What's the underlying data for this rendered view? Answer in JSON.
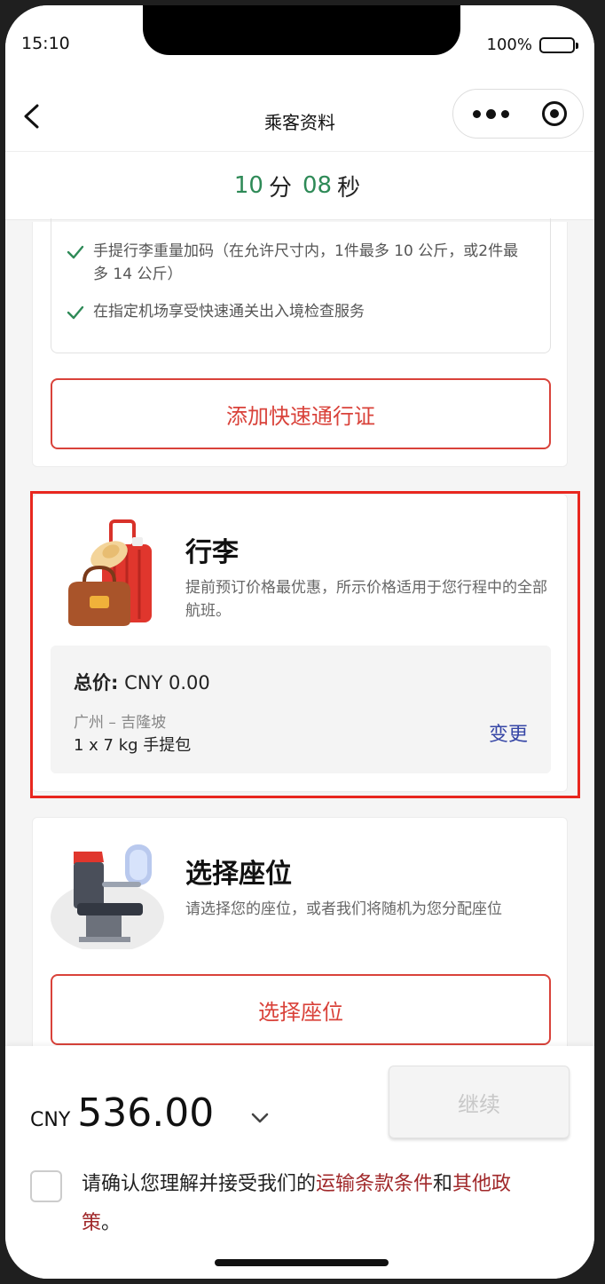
{
  "status_bar": {
    "time": "15:10",
    "battery": "100%"
  },
  "nav": {
    "title": "乘客资料"
  },
  "timer": {
    "minutes": "10",
    "minutes_unit": "分",
    "seconds": "08",
    "seconds_unit": "秒"
  },
  "fast_pass": {
    "benefits": [
      "手提行李重量加码（在允许尺寸内，1件最多 10 公斤，或2件最多 14 公斤）",
      "在指定机场享受快速通关出入境检查服务"
    ],
    "button_label": "添加快速通行证"
  },
  "baggage": {
    "title": "行李",
    "description": "提前预订价格最优惠，所示价格适用于您行程中的全部航班。",
    "total_label": "总价:",
    "total_value": "CNY 0.00",
    "route": "广州 – 吉隆坡",
    "item": "1 x 7 kg 手提包",
    "change_label": "变更"
  },
  "seat": {
    "title": "选择座位",
    "description": "请选择您的座位，或者我们将随机为您分配座位",
    "button_label": "选择座位"
  },
  "footer": {
    "currency": "CNY",
    "amount": "536.00",
    "continue_label": "继续",
    "terms_prefix": "请确认您理解并接受我们的",
    "terms_link1": "运输条款条件",
    "terms_and": "和",
    "terms_link2": "其他政策",
    "terms_suffix": "。"
  },
  "colors": {
    "accent_red": "#d9423a",
    "timer_green": "#2e8a57",
    "link_blue": "#3646a6",
    "highlight_red": "#e8271f"
  }
}
